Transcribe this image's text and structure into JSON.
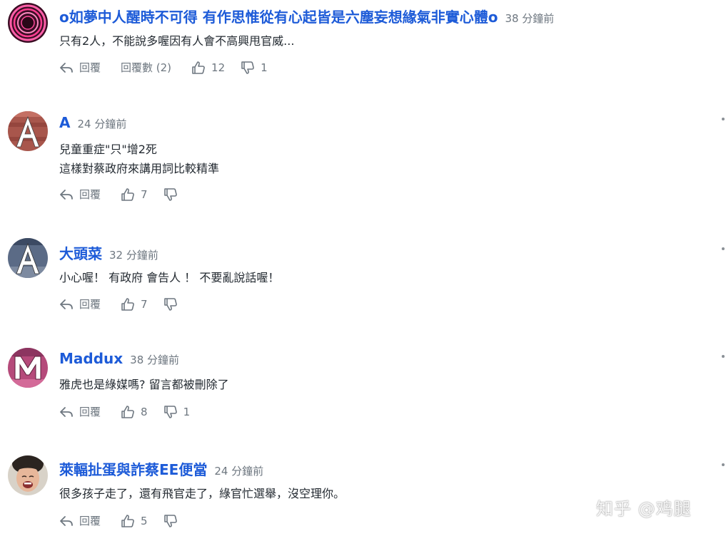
{
  "comments": [
    {
      "author": "o如夢中人醒時不可得 有作思惟從有心起皆是六塵妄想緣氣非實心體o",
      "time": "38 分鐘前",
      "text": "只有2人，不能說多喔因有人會不高興甩官威...",
      "reply_label": "回覆",
      "replies_label": "回覆數 (2)",
      "likes": "12",
      "dislikes": "1"
    },
    {
      "author": "A",
      "time": "24 分鐘前",
      "text": "兒童重症\"只\"增2死\n這樣對蔡政府來講用詞比較精準",
      "reply_label": "回覆",
      "likes": "7",
      "dislikes": ""
    },
    {
      "author": "大頭菜",
      "time": "32 分鐘前",
      "text": "小心喔！ 有政府 會告人 ！ 不要亂說話喔！",
      "reply_label": "回覆",
      "likes": "7",
      "dislikes": ""
    },
    {
      "author": "Maddux",
      "time": "38 分鐘前",
      "text": "雅虎也是綠媒嗎? 留言都被刪除了",
      "reply_label": "回覆",
      "likes": "8",
      "dislikes": "1"
    },
    {
      "author": "萊輻扯蛋與詐蔡EE便當",
      "time": "24 分鐘前",
      "text": "很多孩子走了，還有飛官走了，綠官忙選舉，沒空理你。",
      "reply_label": "回覆",
      "likes": "5",
      "dislikes": ""
    }
  ],
  "avatars": [
    {
      "icon": "neon-rings-avatar-icon"
    },
    {
      "icon": "letter-a-avatar-icon",
      "letter": "A"
    },
    {
      "icon": "letter-a-avatar-icon",
      "letter": "A"
    },
    {
      "icon": "letter-m-avatar-icon",
      "letter": "M"
    },
    {
      "icon": "person-photo-avatar-icon"
    }
  ],
  "watermark": "知乎 @鸡腿",
  "colors": {
    "author": "#1d5bd8",
    "muted": "#6e7780",
    "text": "#232a31"
  }
}
